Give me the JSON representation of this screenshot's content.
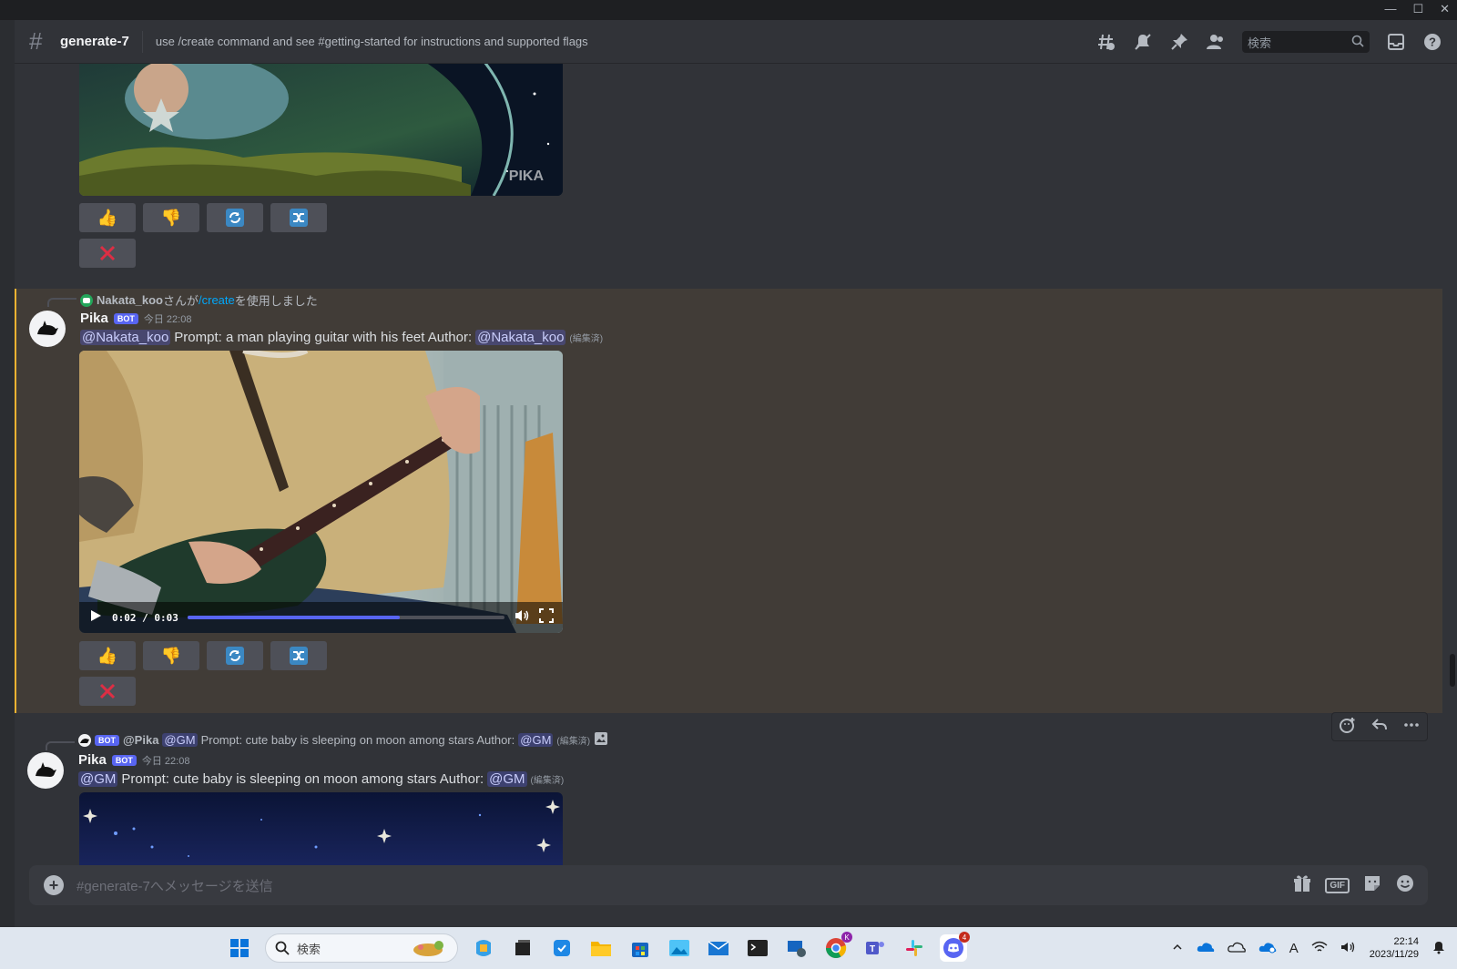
{
  "window": {
    "minimize": "—",
    "maximize": "☐",
    "close": "✕"
  },
  "header": {
    "hash": "#",
    "channel": "generate-7",
    "topic": "use /create command and see #getting-started for instructions and supported flags",
    "search_placeholder": "検索"
  },
  "messages": [
    {
      "reply_user": "Nakata_koo",
      "reply_suffix_1": "さんが",
      "reply_command": "/create",
      "reply_suffix_2": "を使用しました",
      "author": "Pika",
      "bot_tag": "BOT",
      "timestamp": "今日 22:08",
      "mention_1": "@Nakata_koo",
      "prompt": "Prompt: a man playing guitar with his feet  Author:",
      "mention_2": "@Nakata_koo",
      "edited": "(編集済)",
      "video_time": "0:02 / 0:03",
      "video_progress": 0.67
    },
    {
      "reply_bot_tag": "BOT",
      "reply_user": "@Pika",
      "reply_mention": "@GM",
      "reply_text": "Prompt: cute baby is sleeping on moon among stars Author:",
      "reply_mention_2": "@GM",
      "reply_edited": "(編集済)",
      "author": "Pika",
      "bot_tag": "BOT",
      "timestamp": "今日 22:08",
      "mention_1": "@GM",
      "prompt": "Prompt: cute baby is sleeping on moon among stars  Author:",
      "mention_2": "@GM",
      "edited": "(編集済)"
    }
  ],
  "watermark": "PIKA LABS",
  "composer": {
    "placeholder": "#generate-7へメッセージを送信",
    "gif_label": "GIF"
  },
  "taskbar": {
    "search_placeholder": "検索",
    "time": "22:14",
    "date": "2023/11/29",
    "ime": "A",
    "discord_badge": "4"
  },
  "colors": {
    "accent": "#5865f2",
    "highlight_border": "#f0b232",
    "highlight_bg": "#413c37",
    "mention": "#c9cdfb"
  }
}
